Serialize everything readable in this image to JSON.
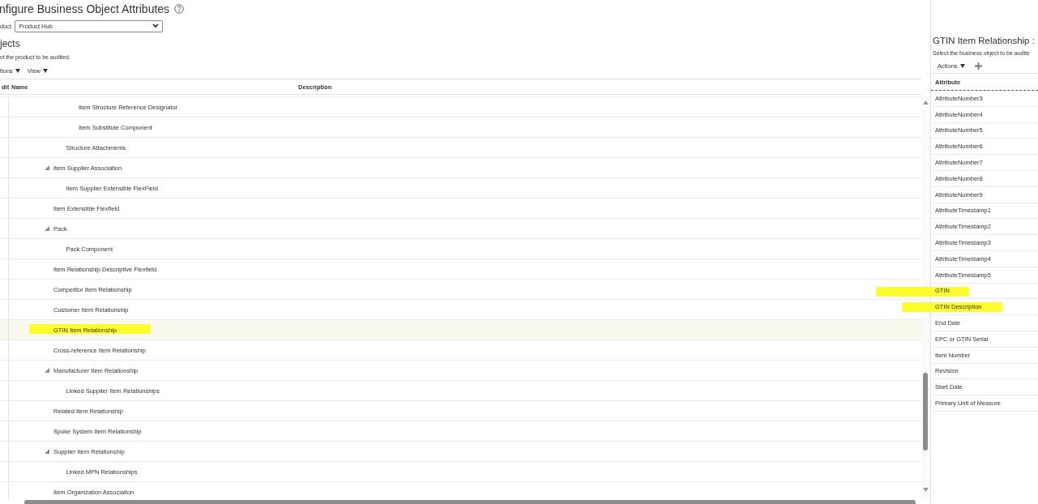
{
  "page": {
    "title": "nfigure Business Object Attributes",
    "product_label": "duct",
    "product_value": "Product Hub"
  },
  "objects": {
    "heading": "jects",
    "instruction": "ct the product to be audited.",
    "toolbar": [
      "tions",
      "View"
    ],
    "columns": [
      "dit",
      "Name",
      "Description"
    ]
  },
  "tree": {
    "rows": [
      {
        "children": [
          {
            "children": [
              {
                "label": "Item Structure Reference Designator",
                "selected": false,
                "highlighted": false
              },
              {
                "label": "Item Substitute Component",
                "selected": false,
                "highlighted": false
              }
            ]
          },
          {
            "label": "Structure Attachments",
            "selected": false,
            "highlighted": false
          }
        ]
      },
      {
        "label": "Item Supplier Association",
        "selected": false,
        "highlighted": false,
        "expanded": true,
        "children": [
          {
            "label": "Item Supplier Extensible FlexField",
            "selected": false,
            "highlighted": false
          }
        ]
      },
      {
        "label": "Item Extensible Flexfield",
        "selected": false,
        "highlighted": false
      },
      {
        "label": "Pack",
        "selected": false,
        "highlighted": false,
        "expanded": true,
        "children": [
          {
            "label": "Pack Component",
            "selected": false,
            "highlighted": false
          }
        ]
      },
      {
        "label": "Item Relationship Descriptive Flexfield",
        "selected": false,
        "highlighted": false
      },
      {
        "label": "Competitor Item Relationship",
        "selected": false,
        "highlighted": false
      },
      {
        "label": "Customer Item Relationship",
        "selected": false,
        "highlighted": false
      },
      {
        "label": "GTIN Item Relationship",
        "selected": true,
        "highlighted": true
      },
      {
        "label": "Cross-reference Item Relationship",
        "selected": false,
        "highlighted": false
      },
      {
        "label": "Manufacturer Item Relationship",
        "selected": false,
        "highlighted": false,
        "expanded": true,
        "children": [
          {
            "label": "Linked Supplier Item Relationships",
            "selected": false,
            "highlighted": false
          }
        ]
      },
      {
        "label": "Related Item Relationship",
        "selected": false,
        "highlighted": false
      },
      {
        "label": "Spoke System Item Relationship",
        "selected": false,
        "highlighted": false
      },
      {
        "label": "Supplier Item Relationship",
        "selected": false,
        "highlighted": false,
        "expanded": true,
        "children": [
          {
            "label": "Linked MPN Relationships",
            "selected": false,
            "highlighted": false
          }
        ]
      },
      {
        "label": "Item Organization Association",
        "selected": false,
        "highlighted": false
      }
    ]
  },
  "attributes_panel": {
    "title": "GTIN Item Relationship :",
    "instruction": "Select the business object to be audite",
    "actions": "Actions",
    "column": "Attribute",
    "rows": [
      {
        "label": "AttributeNumber3",
        "highlighted": false
      },
      {
        "label": "AttributeNumber4",
        "highlighted": false
      },
      {
        "label": "AttributeNumber5",
        "highlighted": false
      },
      {
        "label": "AttributeNumber6",
        "highlighted": false
      },
      {
        "label": "AttributeNumber7",
        "highlighted": false
      },
      {
        "label": "AttributeNumber8",
        "highlighted": false
      },
      {
        "label": "AttributeNumber9",
        "highlighted": false
      },
      {
        "label": "AttributeTimestamp1",
        "highlighted": false
      },
      {
        "label": "AttributeTimestamp2",
        "highlighted": false
      },
      {
        "label": "AttributeTimestamp3",
        "highlighted": false
      },
      {
        "label": "AttributeTimestamp4",
        "highlighted": false
      },
      {
        "label": "AttributeTimestamp5",
        "highlighted": false
      },
      {
        "label": "GTIN",
        "highlighted": true
      },
      {
        "label": "GTIN Description",
        "highlighted": true
      },
      {
        "label": "End Date",
        "highlighted": false
      },
      {
        "label": "EPC or GTIN Serial",
        "highlighted": false
      },
      {
        "label": "Item Number",
        "highlighted": false
      },
      {
        "label": "Revision",
        "highlighted": false
      },
      {
        "label": "Start Date",
        "highlighted": false
      },
      {
        "label": "Primary Unit of Measure",
        "highlighted": false
      }
    ]
  }
}
